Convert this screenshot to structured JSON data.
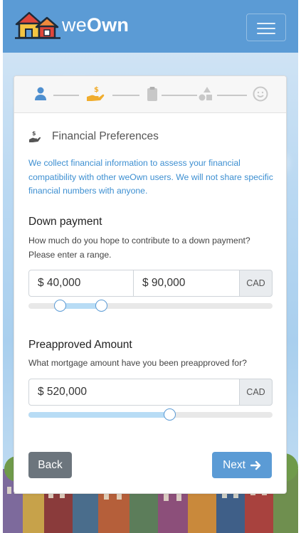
{
  "navbar": {
    "brand_light": "we",
    "brand_bold": "Own",
    "menu_icon": "hamburger-icon"
  },
  "stepper": {
    "steps": [
      {
        "icon": "user-icon",
        "state": "done",
        "color": "#4e8fcf"
      },
      {
        "icon": "hand-dollar-icon",
        "state": "active",
        "color": "#f0ad2e"
      },
      {
        "icon": "clipboard-icon",
        "state": "pending",
        "color": "#c8c8c8"
      },
      {
        "icon": "shapes-icon",
        "state": "pending",
        "color": "#c8c8c8"
      },
      {
        "icon": "smiley-icon",
        "state": "pending",
        "color": "#c8c8c8"
      }
    ]
  },
  "section": {
    "icon": "hand-dollar-icon",
    "title": "Financial Preferences",
    "intro": "We collect financial information to assess your financial compatibility with other weOwn users. We will not share specific financial numbers with anyone."
  },
  "down_payment": {
    "label": "Down payment",
    "help": "How much do you hope to contribute to a down payment? Please enter a range.",
    "min_value": "$ 40,000",
    "max_value": "$ 90,000",
    "currency": "CAD",
    "range_low_fraction": 0.13,
    "range_high_fraction": 0.3
  },
  "preapproved": {
    "label": "Preapproved Amount",
    "help": "What mortgage amount have you been preapproved for?",
    "value": "$ 520,000",
    "currency": "CAD",
    "slider_fraction": 0.58
  },
  "actions": {
    "back_label": "Back",
    "next_label": "Next",
    "next_icon": "arrow-right-icon"
  },
  "colors": {
    "primary": "#5b9bd5",
    "accent": "#f0ad2e",
    "info_text": "#3d8fd1",
    "secondary": "#6c757d"
  }
}
